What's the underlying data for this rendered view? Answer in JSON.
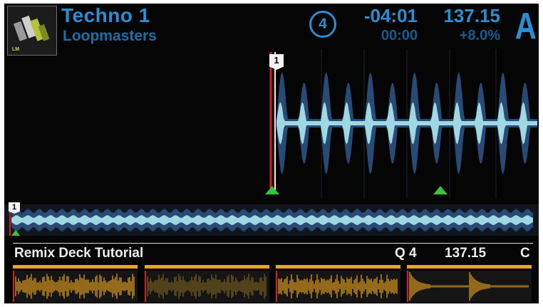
{
  "deck": {
    "cover_label": "LM",
    "title": "Techno 1",
    "artist": "Loopmasters",
    "beat_counter": "4",
    "remaining_time": "-04:01",
    "elapsed_time": "00:00",
    "tempo": "137.15",
    "pitch": "+8.0%",
    "letter": "A"
  },
  "waveform": {
    "cue_label": "1",
    "overview_cue_label": "1",
    "colors": {
      "wave_bright": "#9fd8e2",
      "wave_dark": "#294a74",
      "cue_line": "#d81b1b",
      "marker": "#37c43a"
    }
  },
  "remix": {
    "title": "Remix Deck Tutorial",
    "quantize": "Q 4",
    "tempo": "137.15",
    "key": "C",
    "slots": [
      {
        "id": "slot-1",
        "state": "active",
        "color": "#e8a51f"
      },
      {
        "id": "slot-2",
        "state": "dim",
        "color": "#7a6022"
      },
      {
        "id": "slot-3",
        "state": "active",
        "color": "#e8a51f"
      },
      {
        "id": "slot-4",
        "state": "active",
        "color": "#e8a51f"
      }
    ]
  }
}
